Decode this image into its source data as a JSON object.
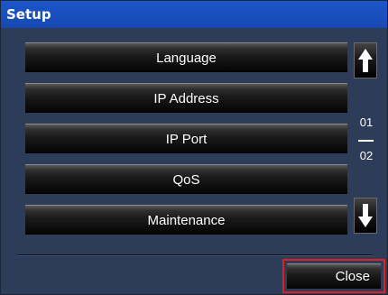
{
  "window": {
    "title": "Setup"
  },
  "menu": {
    "items": [
      {
        "label": "Language"
      },
      {
        "label": "IP Address"
      },
      {
        "label": "IP Port"
      },
      {
        "label": "QoS"
      },
      {
        "label": "Maintenance"
      }
    ]
  },
  "pager": {
    "up_icon": "arrow-up-icon",
    "down_icon": "arrow-down-icon",
    "current_page": "01",
    "total_pages": "02"
  },
  "footer": {
    "close_label": "Close"
  },
  "colors": {
    "title_bar": "#1749b3",
    "background": "#2d3c58",
    "highlight_border": "#e02020"
  }
}
